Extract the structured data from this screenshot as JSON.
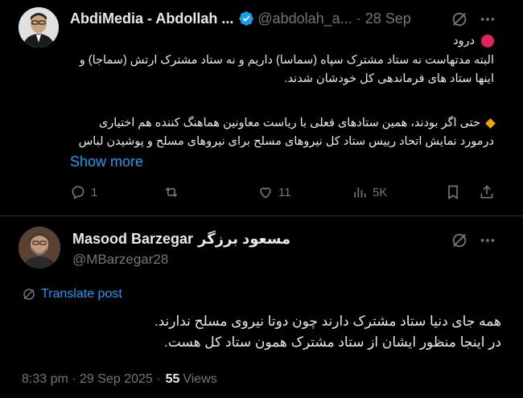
{
  "tweet1": {
    "display_name": "AbdiMedia - Abdollah ...",
    "handle": "@abdolah_a...",
    "date": "28 Sep",
    "greeting": "درود",
    "paragraph1": "البته مدتهاست نه ستاد مشترک سپاه (سماسا) داریم و نه ستاد مشترک ارتش (سماجا) و اینها ستاد های فرماندهی کل خودشان شدند.",
    "paragraph2": "حتی اگر بودند، همین ستادهای فعلی با ریاست معاونین هماهنگ کننده هم اختیاری درمورد نمایش اتحاد رییس ستاد کل نیروهای مسلح برای نیروهای مسلح و پوشیدن لباس",
    "show_more": "Show more",
    "actions": {
      "replies": "1",
      "likes": "11",
      "views": "5K"
    }
  },
  "tweet2": {
    "display_name": "Masood Barzegar",
    "display_name_fa": "مسعود برزگر",
    "handle": "@MBarzegar28",
    "translate_label": "Translate post",
    "line1": "همه جای دنیا ستاد مشترک دارند چون دوتا نیروی مسلح ندارند.",
    "line2": "در اینجا منظور ایشان از ستاد مشترک همون ستاد کل هست.",
    "timestamp": "8:33 pm · 29 Sep 2025 ·",
    "views_count": "55",
    "views_label": "Views"
  },
  "colors": {
    "background": "#000000",
    "text": "#e7e9ea",
    "muted": "#71767b",
    "accent": "#1d9bf0",
    "divider": "#2f3336"
  },
  "icons": {
    "verified": "verified-badge-icon",
    "grok": "grok-icon",
    "more": "more-icon",
    "reply": "reply-icon",
    "retweet": "retweet-icon",
    "like": "like-icon",
    "views": "views-icon",
    "bookmark": "bookmark-icon",
    "share": "share-icon",
    "translate": "translate-icon"
  }
}
